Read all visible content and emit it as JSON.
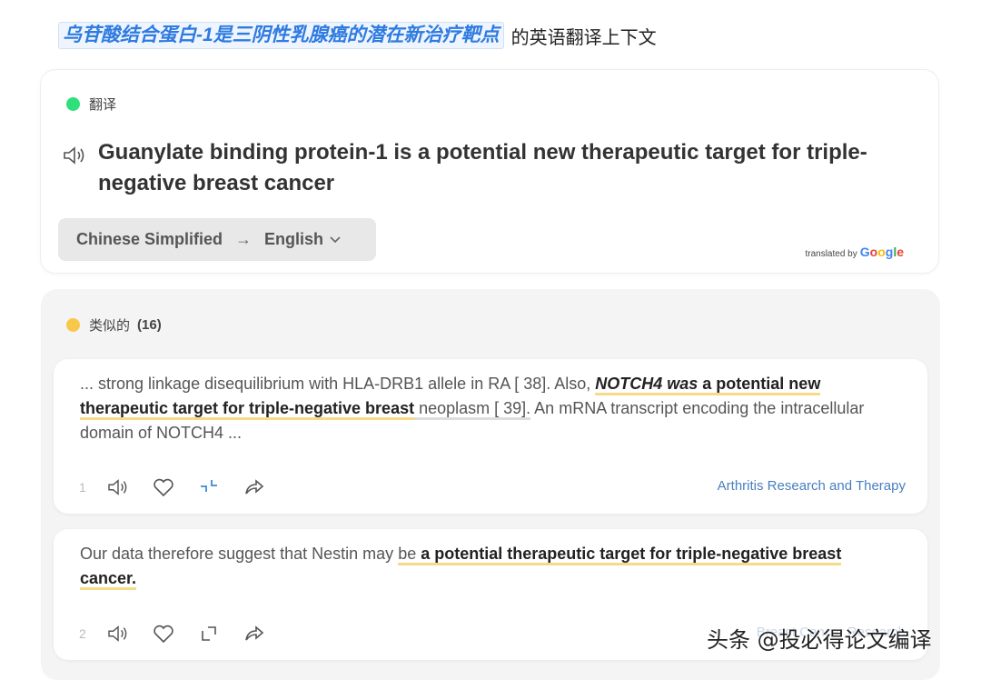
{
  "header": {
    "query": "乌苷酸结合蛋白-1是三阴性乳腺癌的潜在新治疗靶点",
    "suffix": "的英语翻译上下文"
  },
  "translation": {
    "label": "翻译",
    "status_color": "#2ee07a",
    "text": "Guanylate binding protein-1 is a potential new therapeutic target for triple-negative breast cancer",
    "source_lang": "Chinese Simplified",
    "arrow": "→",
    "target_lang": "English",
    "credit_prefix": "translated by",
    "credit_brand": [
      "G",
      "o",
      "o",
      "g",
      "l",
      "e"
    ]
  },
  "similar": {
    "label": "类似的",
    "count": "(16)",
    "status_color": "#f8c84a",
    "results": [
      {
        "parts": {
          "a": "... strong linkage disequilibrium with HLA-DRB1 allele in RA [ 38]. Also, ",
          "b": "NOTCH4 was",
          "c": " a potential new therapeutic target for triple-negative breast",
          "d": " neoplasm [ 39].",
          "e": " An mRNA transcript encoding the intracellular domain of NOTCH4 ..."
        },
        "number": "1",
        "source": "Arthritis Research and Therapy"
      },
      {
        "parts": {
          "a": "Our data therefore suggest that Nestin may ",
          "b": "be",
          "c": " a potential therapeutic target for triple-negative breast cancer."
        },
        "number": "2",
        "source": "Breast Cancer Research"
      }
    ]
  },
  "watermark": "头条 @投必得论文编译",
  "colors": {
    "accent_link": "#4a7fbf",
    "query_blue": "#2f7be0",
    "highlight": "#f7d98a"
  }
}
